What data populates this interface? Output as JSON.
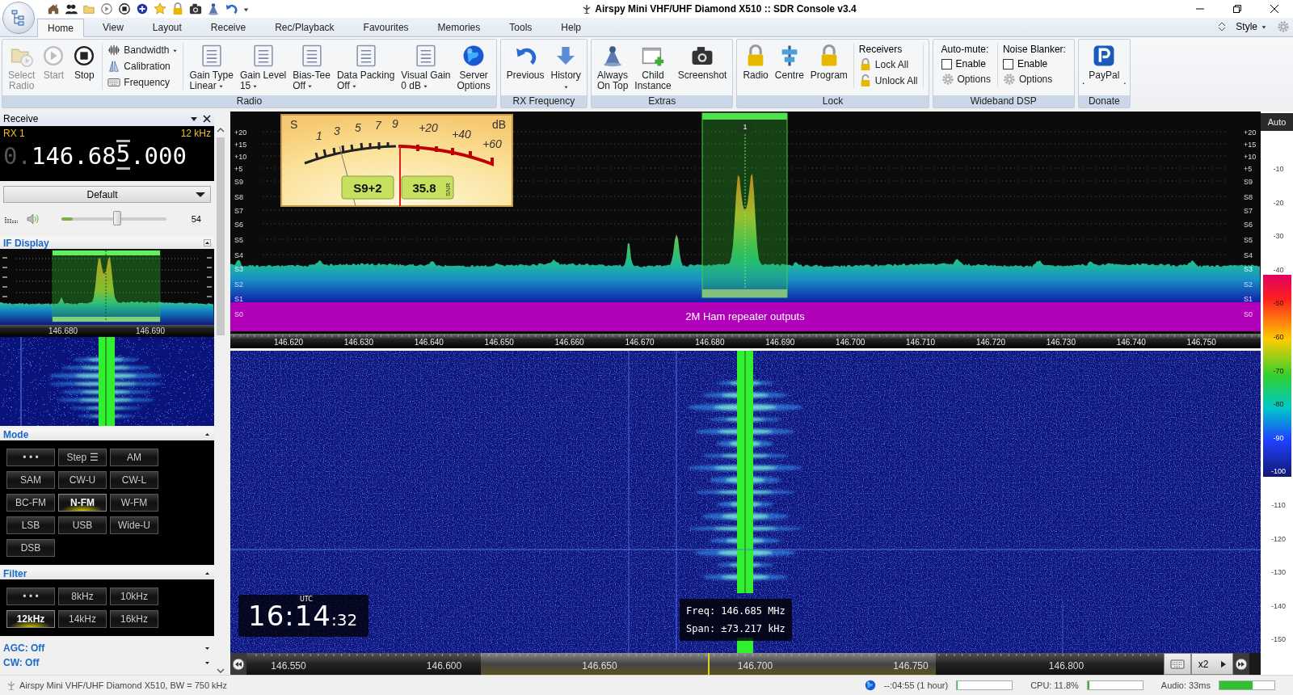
{
  "window": {
    "title": "Airspy Mini VHF/UHF Diamond X510 :: SDR Console v3.4"
  },
  "tabs": [
    {
      "label": "Home",
      "selected": true
    },
    {
      "label": "View",
      "selected": false
    },
    {
      "label": "Layout",
      "selected": false
    },
    {
      "label": "Receive",
      "selected": false
    },
    {
      "label": "Rec/Playback",
      "selected": false
    },
    {
      "label": "Favourites",
      "selected": false
    },
    {
      "label": "Memories",
      "selected": false
    },
    {
      "label": "Tools",
      "selected": false
    },
    {
      "label": "Help",
      "selected": false
    }
  ],
  "style_menu": {
    "label": "Style"
  },
  "ribbon_groups": [
    {
      "label": "Radio",
      "items": [
        {
          "kind": "large",
          "label": "Select\nRadio",
          "disabled": true
        },
        {
          "kind": "large",
          "label": "Start",
          "disabled": true
        },
        {
          "kind": "large",
          "label": "Stop",
          "disabled": false
        },
        {
          "kind": "stack",
          "entries": [
            {
              "label": "Bandwidth",
              "dropdown": true
            },
            {
              "label": "Calibration",
              "dropdown": false
            },
            {
              "label": "Frequency",
              "dropdown": false
            }
          ]
        },
        {
          "kind": "split",
          "label": "Gain Type",
          "value": "Linear"
        },
        {
          "kind": "split",
          "label": "Gain Level",
          "value": "15"
        },
        {
          "kind": "split",
          "label": "Bias-Tee",
          "value": "Off"
        },
        {
          "kind": "split",
          "label": "Data Packing",
          "value": "Off"
        },
        {
          "kind": "split",
          "label": "Visual Gain",
          "value": "0 dB"
        },
        {
          "kind": "large",
          "label": "Server\nOptions",
          "disabled": false
        }
      ]
    },
    {
      "label": "RX Frequency",
      "items": [
        {
          "kind": "large",
          "label": "Previous",
          "disabled": false
        },
        {
          "kind": "menu",
          "label": "History"
        }
      ]
    },
    {
      "label": "Extras",
      "items": [
        {
          "kind": "large",
          "label": "Always\nOn Top",
          "disabled": false
        },
        {
          "kind": "large",
          "label": "Child\nInstance",
          "disabled": false
        },
        {
          "kind": "large",
          "label": "Screenshot",
          "disabled": false
        }
      ]
    },
    {
      "label": "Lock",
      "items": [
        {
          "kind": "large",
          "label": "Radio",
          "disabled": false
        },
        {
          "kind": "large",
          "label": "Centre",
          "disabled": false
        },
        {
          "kind": "large",
          "label": "Program",
          "disabled": false
        },
        {
          "kind": "titled_stack",
          "title": "Receivers",
          "entries": [
            {
              "label": "Lock All"
            },
            {
              "label": "Unlock All"
            }
          ]
        }
      ]
    },
    {
      "label": "Wideband DSP",
      "items": [
        {
          "kind": "checkgroup",
          "title": "Auto-mute:",
          "check": {
            "label": "Enable",
            "checked": false
          },
          "options": "Options"
        },
        {
          "kind": "checkgroup",
          "title": "Noise Blanker:",
          "check": {
            "label": "Enable",
            "checked": false
          },
          "options": "Options"
        }
      ]
    },
    {
      "label": "Donate",
      "items": [
        {
          "kind": "dotted",
          "label": "PayPal",
          "mark": "."
        }
      ]
    }
  ],
  "receive_panel": {
    "title": "Receive",
    "rx_label": "RX 1",
    "bandwidth": "12 kHz",
    "frequency": {
      "prefix": "0.",
      "before": "146.68",
      "cursor": "5",
      "after": ".000"
    },
    "profile": "Default",
    "volume": {
      "level": 0.53,
      "reading": "54"
    }
  },
  "if_display": {
    "title": "IF Display",
    "ticks": [
      "146.680",
      "146.690"
    ]
  },
  "mode": {
    "title": "Mode",
    "buttons": [
      {
        "label": "• • •",
        "selected": false
      },
      {
        "label": "Step ☰",
        "selected": false
      },
      {
        "label": "AM",
        "selected": false
      },
      {
        "label": "SAM",
        "selected": false
      },
      {
        "label": "CW-U",
        "selected": false
      },
      {
        "label": "CW-L",
        "selected": false
      },
      {
        "label": "BC-FM",
        "selected": false
      },
      {
        "label": "N-FM",
        "selected": true
      },
      {
        "label": "W-FM",
        "selected": false
      },
      {
        "label": "LSB",
        "selected": false
      },
      {
        "label": "USB",
        "selected": false
      },
      {
        "label": "Wide-U",
        "selected": false
      },
      {
        "label": "DSB",
        "selected": false
      }
    ]
  },
  "filter": {
    "title": "Filter",
    "buttons": [
      {
        "label": "• • •",
        "selected": false
      },
      {
        "label": "8kHz",
        "selected": false
      },
      {
        "label": "10kHz",
        "selected": false
      },
      {
        "label": "12kHz",
        "selected": true
      },
      {
        "label": "14kHz",
        "selected": false
      },
      {
        "label": "16kHz",
        "selected": false
      }
    ]
  },
  "collapsed_sections": [
    {
      "label": "AGC: Off"
    },
    {
      "label": "CW: Off"
    }
  ],
  "spectrum": {
    "scale": [
      "+20",
      "+15",
      "+10",
      "+5",
      "S9",
      "S8",
      "S7",
      "S6",
      "S5",
      "S4",
      "S3",
      "S2",
      "S1",
      "S0"
    ],
    "right_scale": [
      "+20",
      "+15",
      "+10",
      "+5",
      "S9",
      "S8",
      "S7",
      "S6",
      "S5",
      "S4",
      "S3",
      "S2",
      "S1",
      "S0"
    ],
    "freq_ticks": [
      "146.620",
      "146.630",
      "146.640",
      "146.650",
      "146.660",
      "146.670",
      "146.680",
      "146.690",
      "146.700",
      "146.710",
      "146.720",
      "146.730",
      "146.740",
      "146.750"
    ],
    "band_label": "2M Ham repeater outputs",
    "receiver_marker": "1"
  },
  "s_meter": {
    "unit_left": "S",
    "unit_right": "dB",
    "scale": [
      "1",
      "3",
      "5",
      "7",
      "9"
    ],
    "plus_scale": [
      "+20",
      "+40",
      "+60"
    ],
    "reading": "S9+2",
    "snr": "35.8",
    "snr_label": "SNR"
  },
  "level_scale": {
    "mode": "Auto",
    "ticks": [
      "-10",
      "-20",
      "-30",
      "-40",
      "-50",
      "-60",
      "-70",
      "-80",
      "-90",
      "-100",
      "-110",
      "-120",
      "-130",
      "-140",
      "-150"
    ]
  },
  "waterfall": {
    "clock": {
      "hours_minutes": "16:14",
      "seconds": ":32",
      "zone": "UTC"
    },
    "tooltip": [
      "Freq: 146.685 MHz",
      "Span: ±73.217 kHz"
    ]
  },
  "bottom_bar": {
    "ticks": [
      "146.550",
      "146.600",
      "146.650",
      "146.700",
      "146.750",
      "146.800"
    ],
    "zoom": "x2"
  },
  "status_bar": {
    "device": "Airspy Mini VHF/UHF Diamond X510, BW = 750 kHz",
    "recording": {
      "text": "--:04:55 (1 hour)",
      "level": 0.02
    },
    "cpu": {
      "text": "CPU: 11.8%",
      "level": 0.03
    },
    "audio": {
      "text": "Audio: 33ms",
      "level": 0.6
    }
  }
}
